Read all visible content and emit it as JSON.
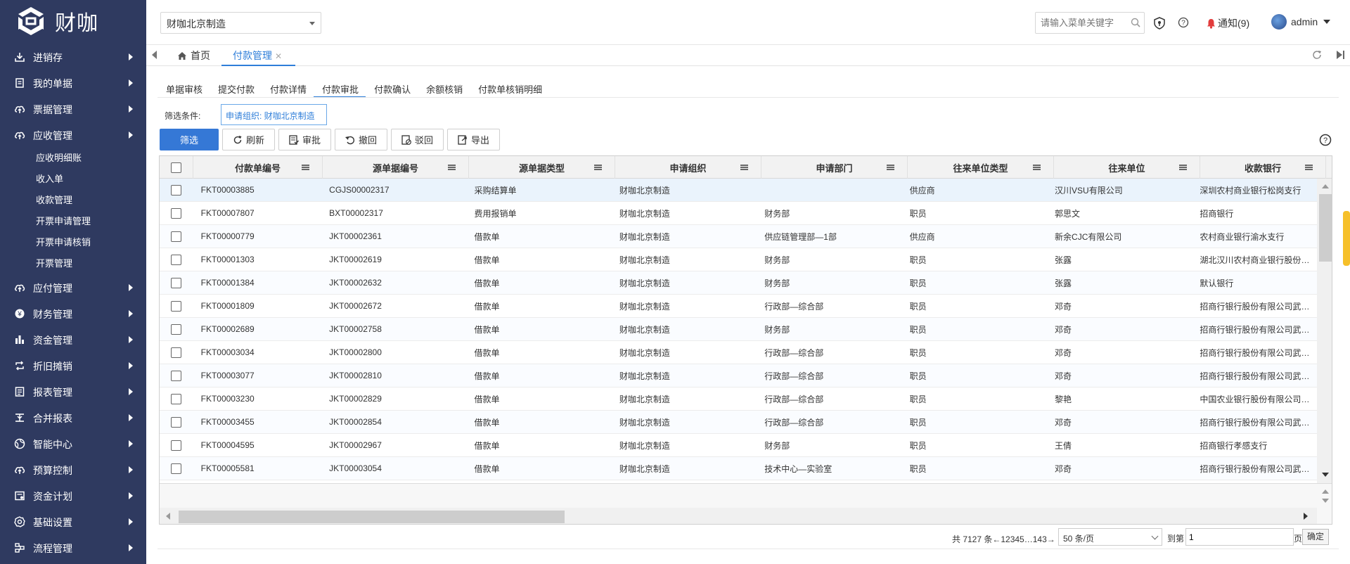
{
  "app": {
    "logo_text": "财咖",
    "brand_color": "#2f3a60",
    "accent": "#2e7ed9"
  },
  "sidebar": {
    "items": [
      {
        "label": "进销存",
        "icon": "download-icon"
      },
      {
        "label": "我的单据",
        "icon": "document-icon"
      },
      {
        "label": "票据管理",
        "icon": "cloud-upload-icon"
      },
      {
        "label": "应收管理",
        "icon": "cloud-upload-icon",
        "expanded": true,
        "children": [
          "应收明细账",
          "收入单",
          "收款管理",
          "开票申请管理",
          "开票申请核销",
          "开票管理"
        ]
      },
      {
        "label": "应付管理",
        "icon": "cloud-upload-icon"
      },
      {
        "label": "财务管理",
        "icon": "coin-icon"
      },
      {
        "label": "资金管理",
        "icon": "bar-chart-icon"
      },
      {
        "label": "折旧摊销",
        "icon": "loop-icon"
      },
      {
        "label": "报表管理",
        "icon": "report-icon"
      },
      {
        "label": "合并报表",
        "icon": "merge-icon"
      },
      {
        "label": "智能中心",
        "icon": "globe-icon"
      },
      {
        "label": "预算控制",
        "icon": "cloud-upload-icon"
      },
      {
        "label": "资金计划",
        "icon": "plan-icon"
      },
      {
        "label": "基础设置",
        "icon": "gear-icon"
      },
      {
        "label": "流程管理",
        "icon": "flow-icon"
      }
    ]
  },
  "header": {
    "org_select": "财咖北京制造",
    "search_placeholder": "请输入菜单关键字",
    "notify_label": "通知(9)",
    "user_name": "admin"
  },
  "tabs": {
    "home": "首页",
    "active": "付款管理"
  },
  "subtabs": [
    "单据审核",
    "提交付款",
    "付款详情",
    "付款审批",
    "付款确认",
    "余额核销",
    "付款单核销明细"
  ],
  "active_subtab": 3,
  "filter": {
    "label": "筛选条件:",
    "chip": "申请组织: 财咖北京制造"
  },
  "toolbar": {
    "filter": "筛选",
    "refresh": "刷新",
    "approve": "审批",
    "withdraw": "撤回",
    "reject": "驳回",
    "export": "导出"
  },
  "columns": [
    "付款单编号",
    "源单据编号",
    "源单据类型",
    "申请组织",
    "申请部门",
    "往来单位类型",
    "往来单位",
    "收款银行"
  ],
  "rows": [
    [
      "FKT00003885",
      "CGJS00002317",
      "采购结算单",
      "财咖北京制造",
      "",
      "供应商",
      "汉川VSU有限公司",
      "深圳农村商业银行松岗支行"
    ],
    [
      "FKT00007807",
      "BXT00002317",
      "费用报销单",
      "财咖北京制造",
      "财务部",
      "职员",
      "郭思文",
      "招商银行"
    ],
    [
      "FKT00000779",
      "JKT00002361",
      "借款单",
      "财咖北京制造",
      "供应链管理部—1部",
      "供应商",
      "新余CJC有限公司",
      "农村商业银行渝水支行"
    ],
    [
      "FKT00001303",
      "JKT00002619",
      "借款单",
      "财咖北京制造",
      "财务部",
      "职员",
      "张露",
      "湖北汉川农村商业银行股份有限公司"
    ],
    [
      "FKT00001384",
      "JKT00002632",
      "借款单",
      "财咖北京制造",
      "财务部",
      "职员",
      "张露",
      "默认银行"
    ],
    [
      "FKT00001809",
      "JKT00002672",
      "借款单",
      "财咖北京制造",
      "行政部—综合部",
      "职员",
      "邓奇",
      "招商行银行股份有限公司武汉分行"
    ],
    [
      "FKT00002689",
      "JKT00002758",
      "借款单",
      "财咖北京制造",
      "财务部",
      "职员",
      "邓奇",
      "招商行银行股份有限公司武汉分行"
    ],
    [
      "FKT00003034",
      "JKT00002800",
      "借款单",
      "财咖北京制造",
      "行政部—综合部",
      "职员",
      "邓奇",
      "招商行银行股份有限公司武汉分行"
    ],
    [
      "FKT00003077",
      "JKT00002810",
      "借款单",
      "财咖北京制造",
      "行政部—综合部",
      "职员",
      "邓奇",
      "招商行银行股份有限公司武汉分行"
    ],
    [
      "FKT00003230",
      "JKT00002829",
      "借款单",
      "财咖北京制造",
      "行政部—综合部",
      "职员",
      "黎艳",
      "中国农业银行股份有限公司汉川支行"
    ],
    [
      "FKT00003455",
      "JKT00002854",
      "借款单",
      "财咖北京制造",
      "行政部—综合部",
      "职员",
      "邓奇",
      "招商行银行股份有限公司武汉分行"
    ],
    [
      "FKT00004595",
      "JKT00002967",
      "借款单",
      "财咖北京制造",
      "财务部",
      "职员",
      "王倩",
      "招商银行孝感支行"
    ],
    [
      "FKT00005581",
      "JKT00003054",
      "借款单",
      "财咖北京制造",
      "技术中心—实验室",
      "职员",
      "邓奇",
      "招商行银行股份有限公司武汉分行"
    ]
  ],
  "pager": {
    "summary": "共 7127 条←12345…143→",
    "page_size": "50 条/页",
    "goto_label": "到第",
    "goto_value": "1",
    "page_unit": "页",
    "confirm": "确定"
  }
}
